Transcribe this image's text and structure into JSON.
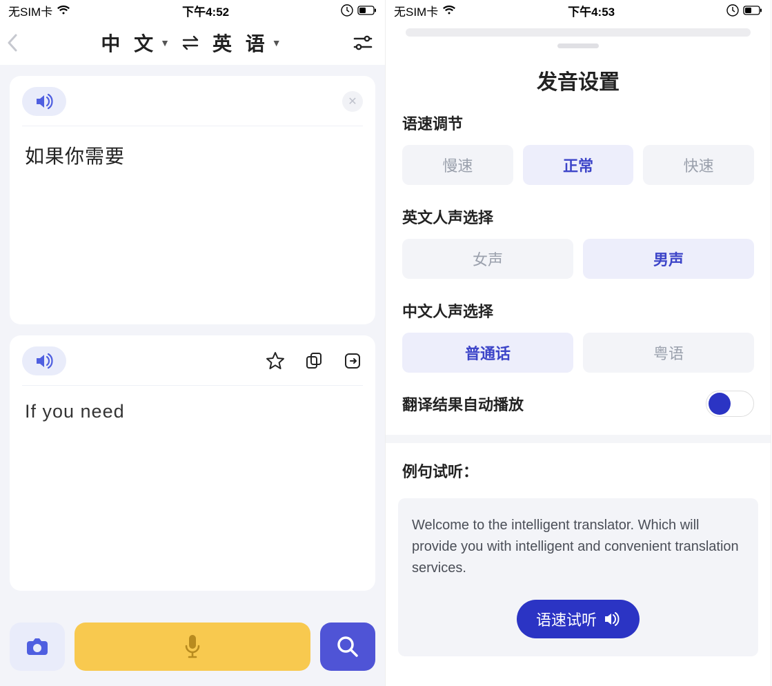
{
  "left": {
    "status": {
      "carrier": "无SIM卡",
      "time": "下午4:52"
    },
    "header": {
      "source_lang": "中 文",
      "target_lang": "英 语"
    },
    "source_text": "如果你需要",
    "target_text": "If you need"
  },
  "right": {
    "status": {
      "carrier": "无SIM卡",
      "time": "下午4:53"
    },
    "title": "发音设置",
    "speed": {
      "label": "语速调节",
      "options": [
        "慢速",
        "正常",
        "快速"
      ],
      "selected": 1
    },
    "en_voice": {
      "label": "英文人声选择",
      "options": [
        "女声",
        "男声"
      ],
      "selected": 1
    },
    "zh_voice": {
      "label": "中文人声选择",
      "options": [
        "普通话",
        "粤语"
      ],
      "selected": 0
    },
    "autoplay": {
      "label": "翻译结果自动播放",
      "on": true
    },
    "sample": {
      "label": "例句试听：",
      "text": "Welcome to the intelligent translator. Which will provide you with intelligent and convenient translation services.",
      "button": "语速试听"
    }
  }
}
